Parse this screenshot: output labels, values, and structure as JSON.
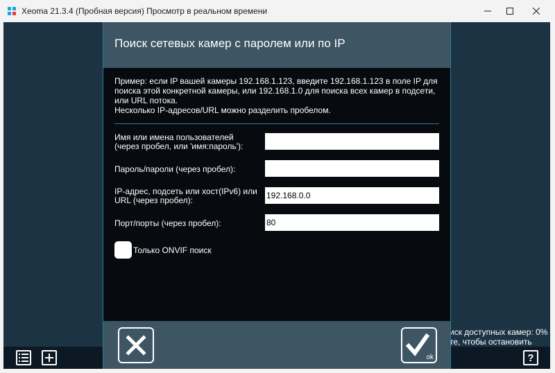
{
  "window": {
    "title": "Xeoma 21.3.4 (Пробная версия) Просмотр в реальном времени"
  },
  "dialog": {
    "title": "Поиск сетевых камер с паролем или по IP",
    "description": [
      "Пример: если IP вашей камеры 192.168.1.123, введите 192.168.1.123 в поле IP для",
      "поиска этой конкретной камеры, или 192.168.1.0 для поиска всех камер в подсети,",
      "или URL потока.",
      "Несколько IP-адресов/URL можно разделить пробелом."
    ],
    "fields": {
      "users": {
        "label_line1": "Имя или имена пользователей",
        "label_line2": "(через пробел, или 'имя:пароль'):",
        "value": ""
      },
      "passwords": {
        "label": "Пароль/пароли (через пробел):",
        "value": ""
      },
      "ip": {
        "label_line1": "IP-адрес, подсеть или хост(IPv6) или",
        "label_line2": "URL (через пробел):",
        "value": "192.168.0.0"
      },
      "ports": {
        "label": "Порт/порты (через пробел):",
        "value": "80"
      }
    },
    "onvif_only": {
      "label": "Только ONVIF поиск",
      "checked": false
    },
    "ok_label": "ok"
  },
  "status": {
    "line1": "иск доступных камер: 0%",
    "line2": "те, чтобы остановить"
  },
  "colors": {
    "background": "#1c3343",
    "dialog_bg": "#070b0f",
    "header_bg": "#3e5563",
    "accent": "#2b7b9a"
  }
}
